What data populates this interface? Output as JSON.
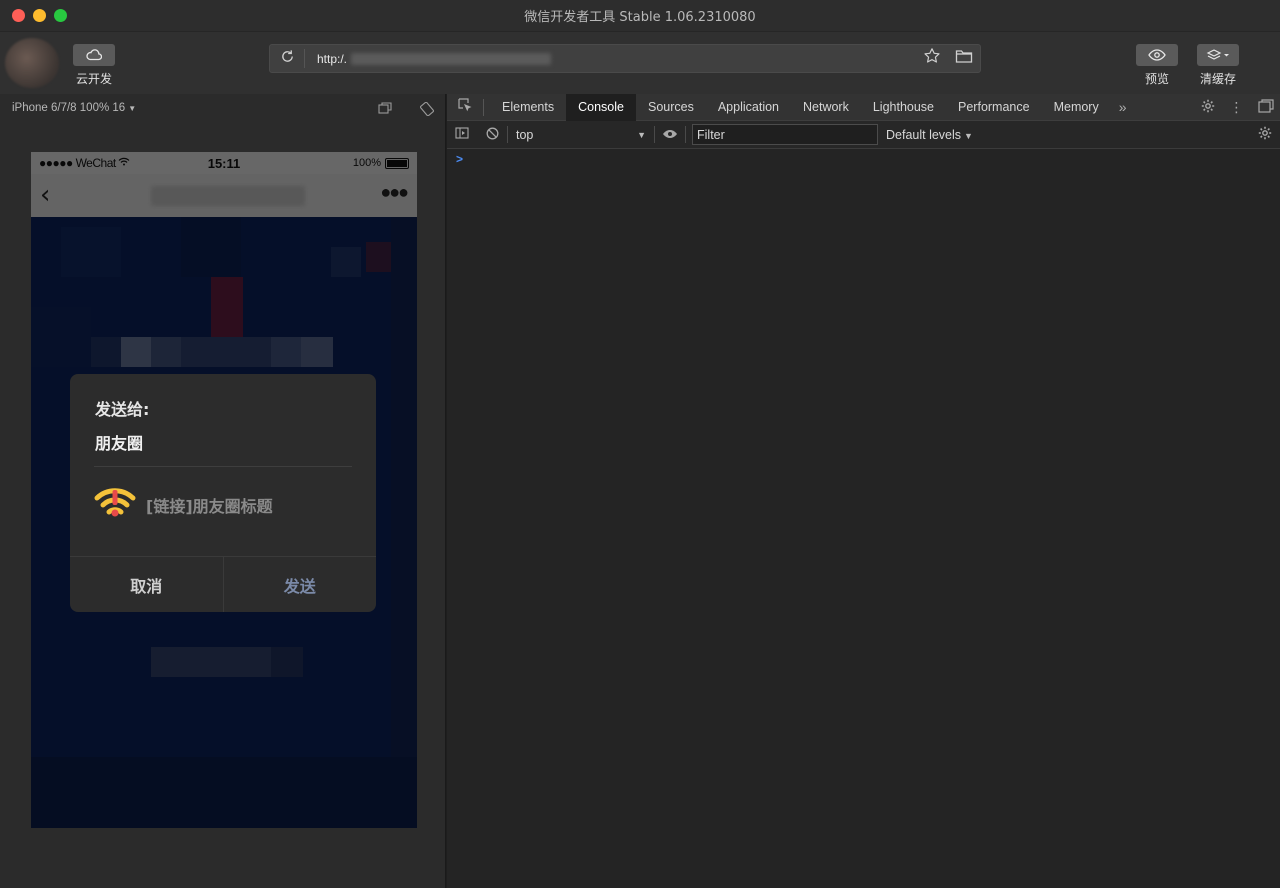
{
  "window": {
    "title": "微信开发者工具 Stable 1.06.2310080"
  },
  "toolbar": {
    "cloud_label": "云开发",
    "preview_label": "预览",
    "clear_cache_label": "清缓存",
    "address": {
      "url_prefix": "http:/."
    }
  },
  "simulator": {
    "device_label": "iPhone 6/7/8 100% 16",
    "status_bar": {
      "carrier": "●●●●● WeChat",
      "time": "15:11",
      "battery": "100%"
    },
    "dialog": {
      "send_to_label": "发送给:",
      "target": "朋友圈",
      "share_title": "[链接]朋友圈标题",
      "cancel_label": "取消",
      "send_label": "发送"
    }
  },
  "devtools": {
    "tabs": [
      "Elements",
      "Console",
      "Sources",
      "Application",
      "Network",
      "Lighthouse",
      "Performance",
      "Memory"
    ],
    "active_tab": "Console",
    "more_tabs": "»",
    "console": {
      "context": "top",
      "filter_placeholder": "Filter",
      "levels": "Default levels",
      "prompt": ">"
    }
  },
  "colors": {
    "accent_prompt": "#4c8df6",
    "dialog_send": "#7b8aa8",
    "phone_background": "#0c1c47"
  }
}
